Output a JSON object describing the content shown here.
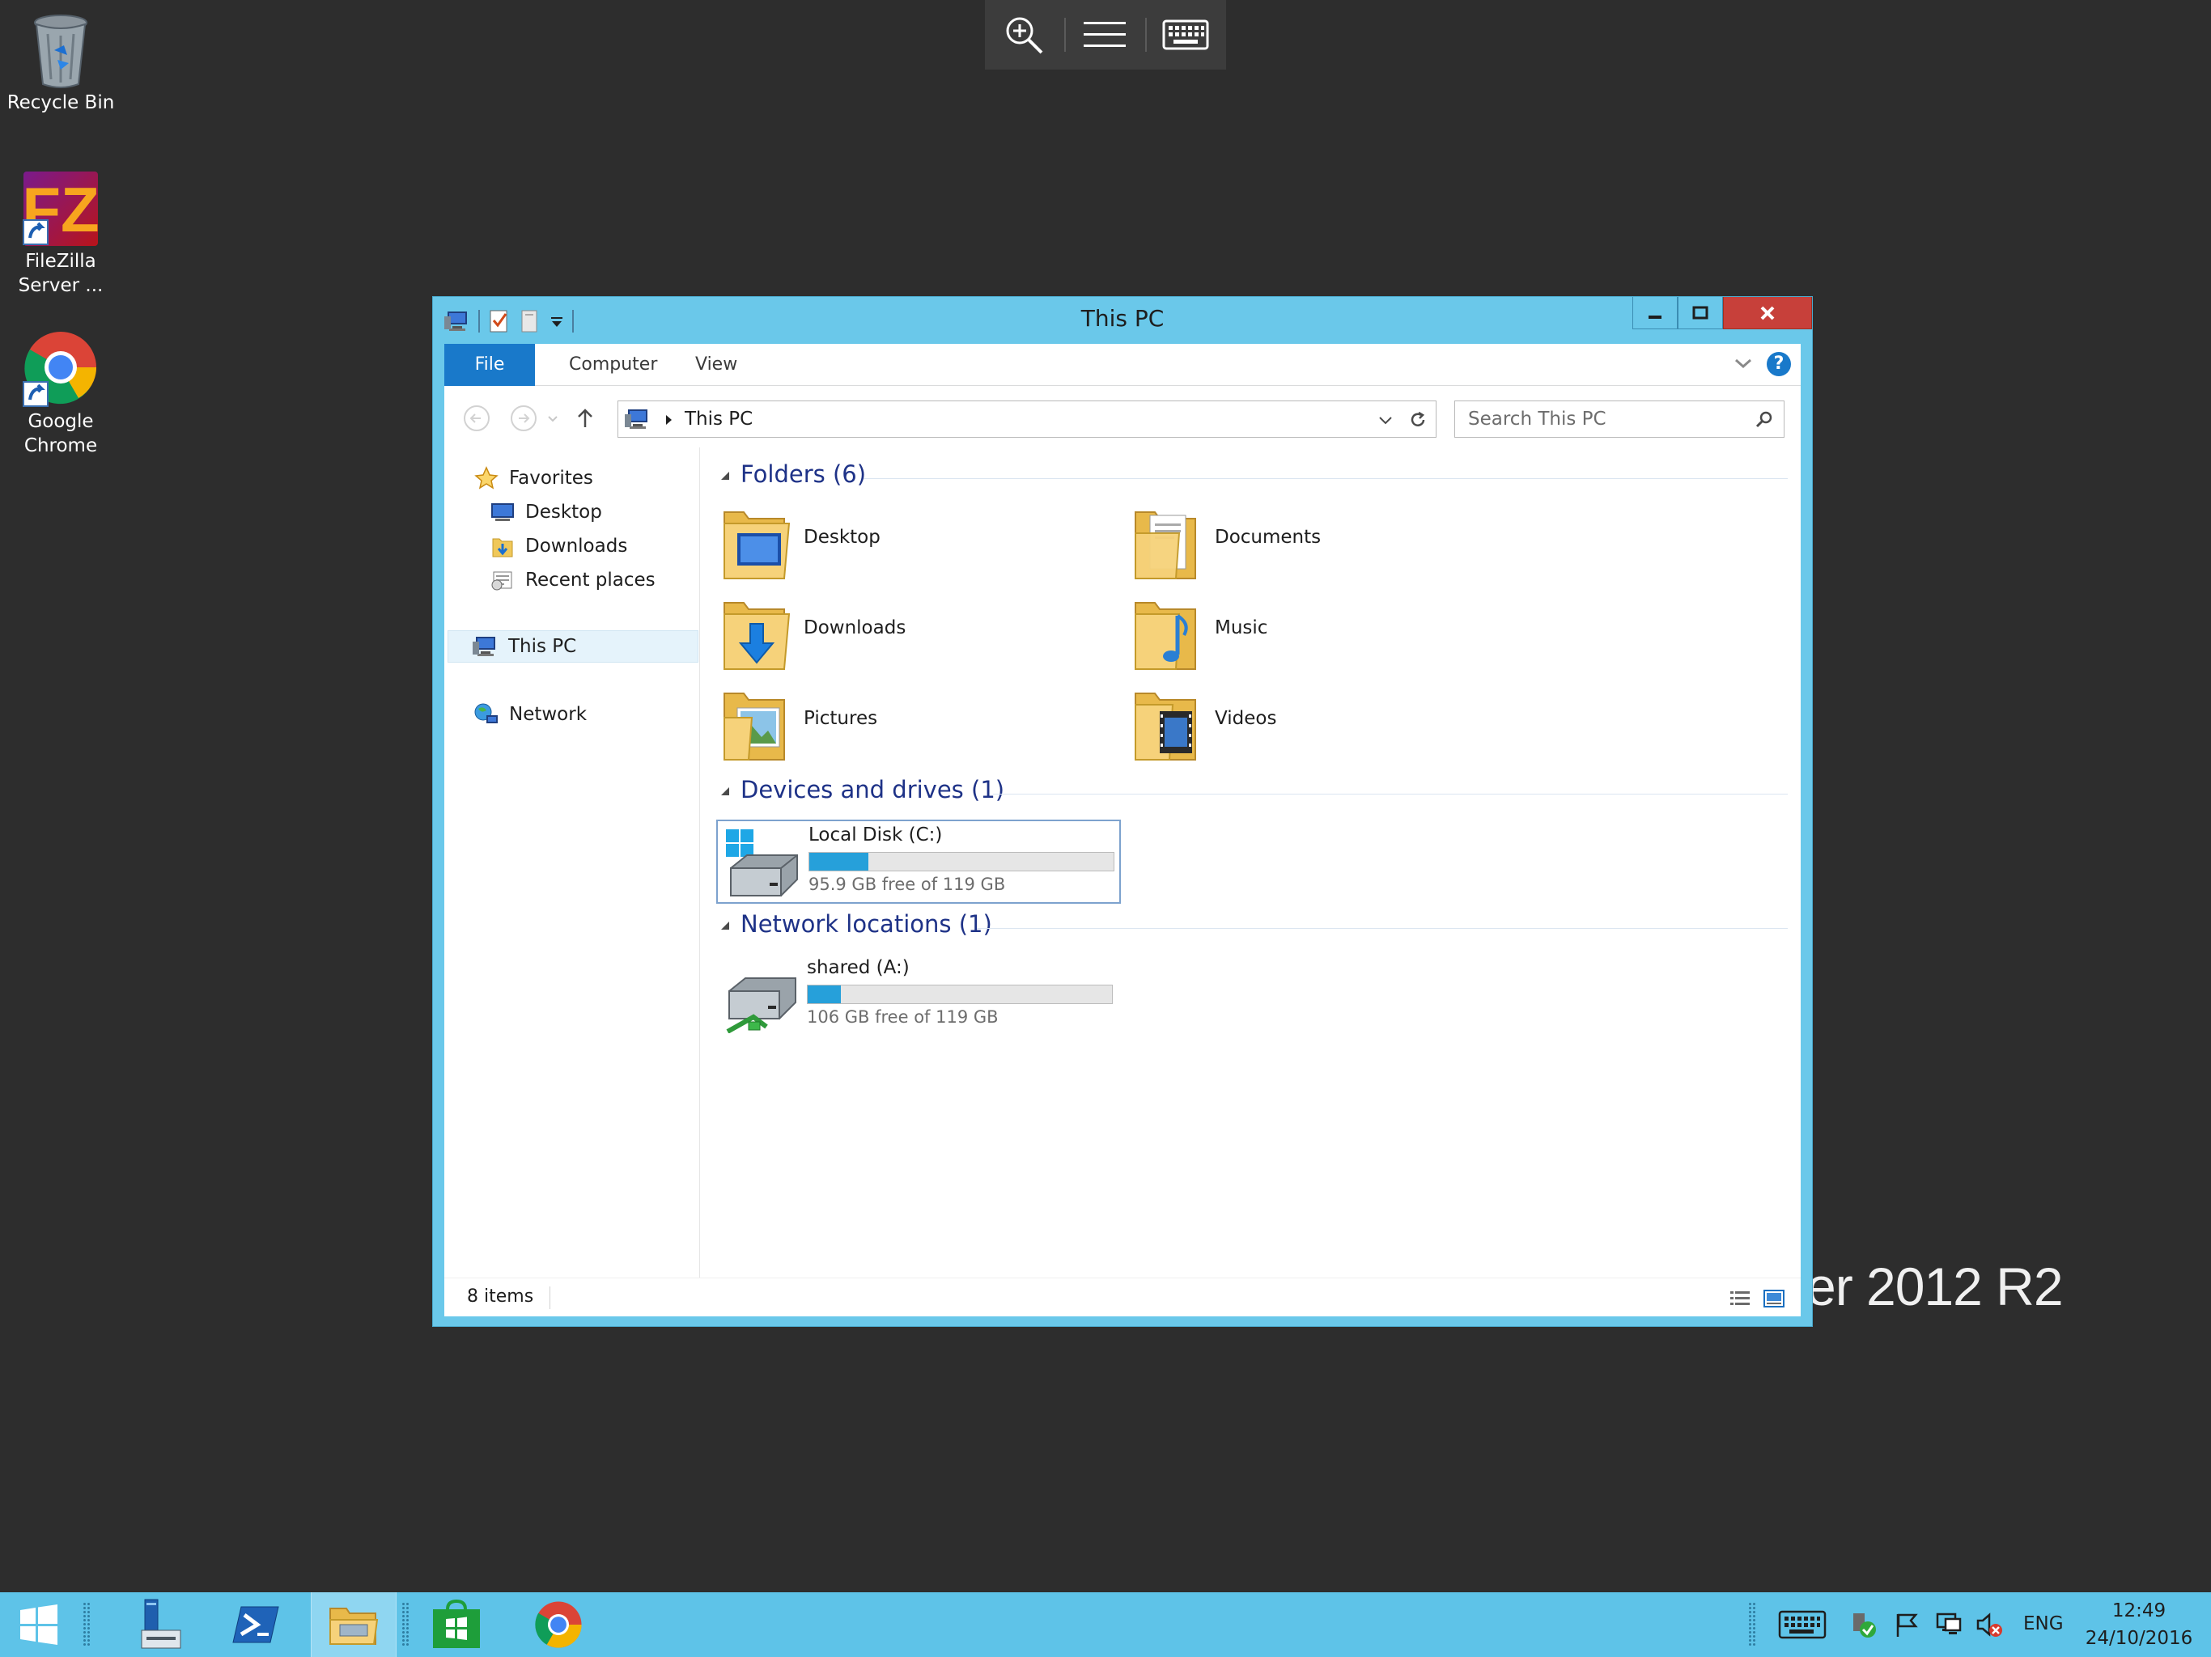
{
  "desktop": {
    "icons": [
      {
        "label_line1": "Recycle Bin",
        "label_line2": ""
      },
      {
        "label_line1": "FileZilla",
        "label_line2": "Server ..."
      },
      {
        "label_line1": "Google",
        "label_line2": "Chrome"
      }
    ],
    "watermark": "er 2012 R2"
  },
  "explorer": {
    "title": "This PC",
    "ribbon_tabs": [
      "File",
      "Computer",
      "View"
    ],
    "help_label": "?",
    "address": "This PC",
    "search_placeholder": "Search This PC",
    "nav": {
      "favorites": "Favorites",
      "favorite_items": [
        "Desktop",
        "Downloads",
        "Recent places"
      ],
      "this_pc": "This PC",
      "network": "Network"
    },
    "groups": {
      "folders": "Folders (6)",
      "devices": "Devices and drives (1)",
      "network": "Network locations (1)"
    },
    "folders": [
      "Desktop",
      "Documents",
      "Downloads",
      "Music",
      "Pictures",
      "Videos"
    ],
    "drives": [
      {
        "name": "Local Disk (C:)",
        "free": "95.9 GB free of 119 GB",
        "used_fraction": 0.194
      },
      {
        "name": "shared (A:)",
        "free": "106 GB free of 119 GB",
        "used_fraction": 0.109
      }
    ],
    "status": "8 items"
  },
  "taskbar": {
    "language": "ENG",
    "time": "12:49",
    "date": "24/10/2016"
  },
  "colors": {
    "window_frame": "#6ac8ea",
    "file_tab": "#1979ca",
    "group_header": "#1e3287",
    "taskbar": "#5ec3e8",
    "close_button": "#c7403a",
    "drive_bar": "#26a0da"
  }
}
